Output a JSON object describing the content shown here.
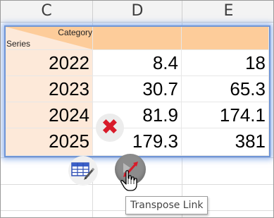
{
  "column_headers": [
    "C",
    "D",
    "E"
  ],
  "table": {
    "corner_top_label": "Category",
    "corner_bottom_label": "Series",
    "rows": [
      {
        "label": "2022",
        "d": "8.4",
        "e": "18"
      },
      {
        "label": "2023",
        "d": "30.7",
        "e": "65.3"
      },
      {
        "label": "2024",
        "d": "81.9",
        "e": "174.1"
      },
      {
        "label": "2025",
        "d": "179.3",
        "e": "381"
      }
    ]
  },
  "controls": {
    "delete_icon": "close-x-icon",
    "edit_icon": "table-edit-icon",
    "link_icon": "transpose-link-icon",
    "cursor_icon": "hand-pointer-icon"
  },
  "tooltip": {
    "text": "Transpose Link"
  },
  "colors": {
    "header_fill": "#fdcc9a",
    "row_header_fill": "#fde9d9",
    "selection_border": "#6f95d6",
    "delete_red": "#d81b2a",
    "link_red": "#d81b2a"
  }
}
